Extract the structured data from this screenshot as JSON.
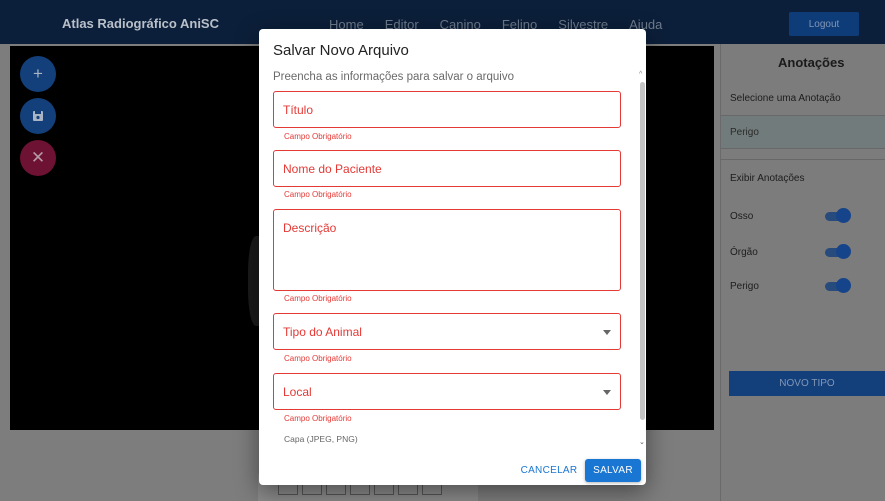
{
  "app": {
    "title": "Atlas Radiográfico AniSC",
    "nav": [
      "Home",
      "Editor",
      "Canino",
      "Felino",
      "Silvestre",
      "Ajuda"
    ],
    "logout_label": "Logout"
  },
  "fabs": {
    "add_icon": "plus-icon",
    "save_icon": "floppy-disk-icon",
    "close_icon": "close-icon",
    "add_glyph": "+",
    "save_glyph": "🖫",
    "close_glyph": "✕"
  },
  "panel": {
    "title": "Anotações",
    "select_label": "Selecione uma Anotação",
    "selected_value": "Perigo",
    "show_label": "Exibir Anotações",
    "toggles": [
      {
        "label": "Osso",
        "on": true
      },
      {
        "label": "Órgão",
        "on": true
      },
      {
        "label": "Perigo",
        "on": true
      }
    ],
    "new_type_label": "NOVO TIPO"
  },
  "modal": {
    "title": "Salvar Novo Arquivo",
    "intro": "Preencha as informações para salvar o arquivo",
    "fields": [
      {
        "label": "Título",
        "helper": "Campo Obrigatório"
      },
      {
        "label": "Nome do Paciente",
        "helper": "Campo Obrigatório"
      },
      {
        "label": "Descrição",
        "helper": "Campo Obrigatório"
      },
      {
        "label": "Tipo do Animal",
        "helper": "Campo Obrigatório"
      },
      {
        "label": "Local",
        "helper": "Campo Obrigatório"
      }
    ],
    "capa_label": "Capa (JPEG, PNG)",
    "cancel_label": "CANCELAR",
    "save_label": "SALVAR",
    "error_color": "#e53935",
    "primary_color": "#1976d2"
  }
}
